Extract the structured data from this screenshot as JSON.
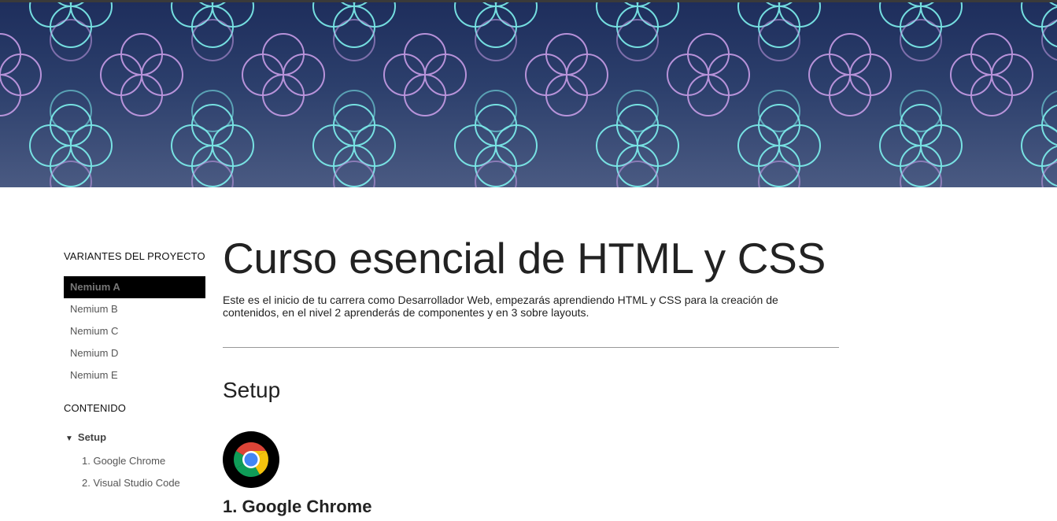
{
  "hero": {
    "pattern_icon": "quatrefoil-pattern",
    "colors": {
      "top": "#1e2e5c",
      "bottom": "#4a5a82",
      "ring_violet": "#c79ce6",
      "ring_cyan": "#7ef1ee"
    }
  },
  "sidebar": {
    "variants_heading": "VARIANTES DEL PROYECTO",
    "variants": [
      {
        "label": "Nemium A",
        "active": true
      },
      {
        "label": "Nemium B"
      },
      {
        "label": "Nemium C"
      },
      {
        "label": "Nemium D"
      },
      {
        "label": "Nemium E"
      }
    ],
    "contents_heading": "CONTENIDO",
    "toc": {
      "section_label": "Setup",
      "items": [
        {
          "label": "1. Google Chrome"
        },
        {
          "label": "2. Visual Studio Code"
        }
      ]
    }
  },
  "main": {
    "title": "Curso esencial de HTML y CSS",
    "intro": "Este es el inicio de tu carrera como Desarrollador Web, empezarás aprendiendo HTML y CSS para la creación de contenidos, en el nivel 2 aprenderás de componentes y en 3 sobre layouts.",
    "section_title": "Setup",
    "app": {
      "icon": "chrome-icon",
      "title": "1. Google Chrome"
    }
  }
}
